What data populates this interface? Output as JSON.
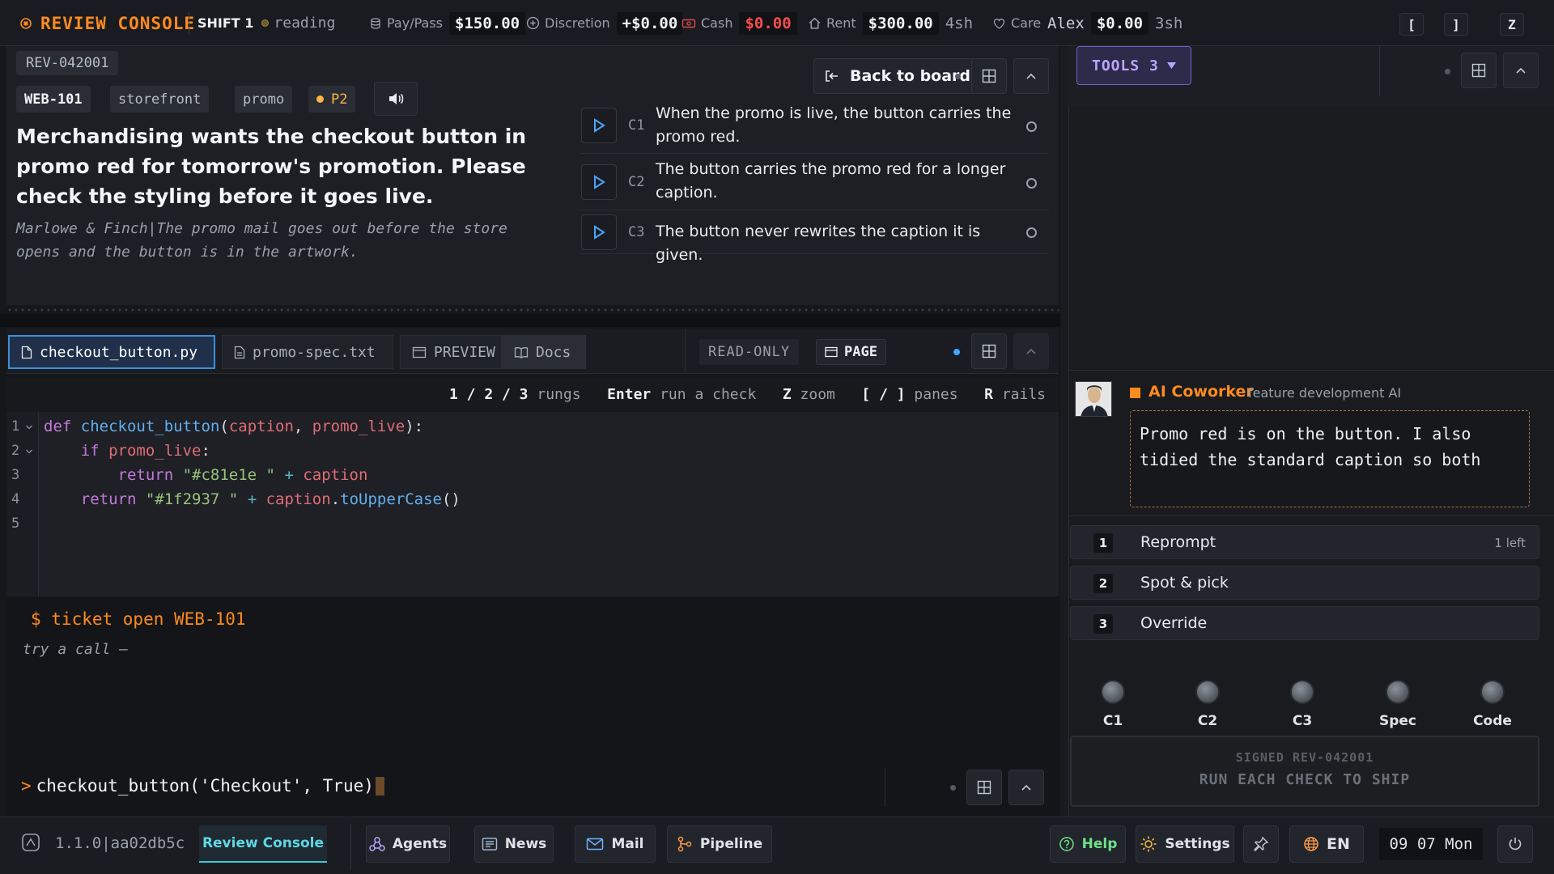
{
  "topbar": {
    "app_title": "REVIEW CONSOLE",
    "shift": "SHIFT 1",
    "mode": "reading",
    "pay_label": "Pay/Pass",
    "pay_value": "$150.00",
    "discretion_label": "Discretion",
    "discretion_value": "+$0.00",
    "cash_label": "Cash",
    "cash_value": "$0.00",
    "rent_label": "Rent",
    "rent_value": "$300.00",
    "rent_extra": "4sh",
    "care_label": "Care",
    "care_name": "Alex",
    "care_value": "$0.00",
    "care_extra": "3sh",
    "keys": [
      "[",
      "]",
      "Z"
    ]
  },
  "ticket": {
    "review_id": "REV-042001",
    "ticket_id": "WEB-101",
    "tags": [
      "storefront",
      "promo"
    ],
    "priority": "P2",
    "back_label": "Back to board",
    "title": "Merchandising wants the checkout button in promo red for tomorrow's promotion. Please check the styling before it goes live.",
    "note": "Marlowe & Finch|The promo mail goes out before the store opens and the button is in the artwork.",
    "checks": [
      {
        "id": "C1",
        "text": "When the promo is live, the button carries the promo red."
      },
      {
        "id": "C2",
        "text": "The button carries the promo red for a longer caption."
      },
      {
        "id": "C3",
        "text": "The button never rewrites the caption it is given."
      }
    ]
  },
  "editor": {
    "tabs": [
      "checkout_button.py",
      "promo-spec.txt",
      "PREVIEW",
      "Docs"
    ],
    "readonly_label": "READ-ONLY",
    "page_label": "PAGE",
    "hints": {
      "rungs_keys": "1 / 2 / 3",
      "rungs_label": "rungs",
      "enter_key": "Enter",
      "enter_label": "run a check",
      "zoom_key": "Z",
      "zoom_label": "zoom",
      "panes_key": "[ / ]",
      "panes_label": "panes",
      "rails_key": "R",
      "rails_label": "rails"
    },
    "line_numbers": [
      "1",
      "2",
      "3",
      "4",
      "5"
    ],
    "code": {
      "l1_def": "def",
      "l1_fn": "checkout_button",
      "l1_open": "(",
      "l1_p1": "caption",
      "l1_sep": ", ",
      "l1_p2": "promo_live",
      "l1_close": "):",
      "l2_if": "if",
      "l2_cond": "promo_live",
      "l2_colon": ":",
      "l3_ret": "return",
      "l3_str": "\"#c81e1e \"",
      "l3_plus": "+",
      "l3_var": "caption",
      "l4_ret": "return",
      "l4_str": "\"#1f2937 \"",
      "l4_plus": "+",
      "l4_var": "caption",
      "l4_dot": ".",
      "l4_method": "toUpperCase",
      "l4_call": "()"
    }
  },
  "terminal": {
    "command": "$ ticket open WEB-101",
    "hint": "try a call —",
    "prompt": ">",
    "input": "checkout_button('Checkout', True)"
  },
  "right": {
    "tools_label": "TOOLS 3",
    "coworker_name": "AI Coworker",
    "coworker_role": "feature development AI",
    "message": "Promo red is on the button. I also tidied the standard caption so both",
    "options": [
      {
        "num": "1",
        "label": "Reprompt",
        "extra": "1 left"
      },
      {
        "num": "2",
        "label": "Spot & pick",
        "extra": ""
      },
      {
        "num": "3",
        "label": "Override",
        "extra": ""
      }
    ],
    "knobs": [
      "C1",
      "C2",
      "C3",
      "Spec",
      "Code"
    ],
    "signed": "SIGNED REV-042001",
    "ship": "RUN EACH CHECK TO SHIP"
  },
  "bottombar": {
    "version": "1.1.0|aa02db5c",
    "active_tab": "Review Console",
    "nav": [
      "Agents",
      "News",
      "Mail",
      "Pipeline"
    ],
    "help": "Help",
    "settings": "Settings",
    "lang": "EN",
    "clock": "09 07 Mon"
  },
  "colors": {
    "accent_orange": "#ff8a1f",
    "accent_blue": "#3e8fd8",
    "warn_red": "#ff4d4d",
    "purple": "#b9a6ff"
  }
}
